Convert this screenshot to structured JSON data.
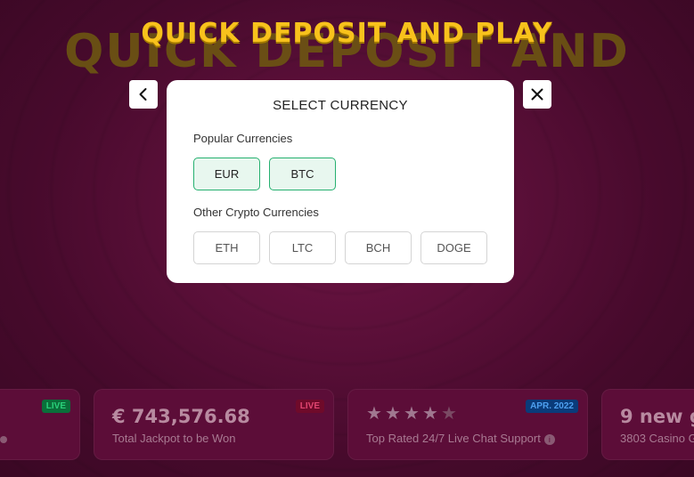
{
  "hero": {
    "title": "QUICK DEPOSIT AND PLAY",
    "title_shadow": "QUICK DEPOSIT AND PLAY"
  },
  "modal": {
    "title": "SELECT CURRENCY",
    "popular_label": "Popular Currencies",
    "popular": [
      "EUR",
      "BTC"
    ],
    "other_label": "Other Crypto Currencies",
    "other": [
      "ETH",
      "LTC",
      "BCH",
      "DOGE"
    ],
    "back_icon": "chevron-left-icon",
    "close_icon": "close-icon"
  },
  "ticker": {
    "card0_badge": "LIVE",
    "card1_amount": "€ 743,576.68",
    "card1_sub": "Total Jackpot to be Won",
    "card1_badge": "LIVE",
    "card2_rating": 4,
    "card2_rating_max": 5,
    "card2_sub": "Top Rated 24/7 Live Chat Support",
    "card2_badge": "APR. 2022",
    "card3_amount": "9 new g",
    "card3_sub": "3803 Casino G"
  },
  "colors": {
    "accent_yellow": "#f8c21c",
    "popular_border": "#26b070",
    "background": "#5a0f38"
  }
}
